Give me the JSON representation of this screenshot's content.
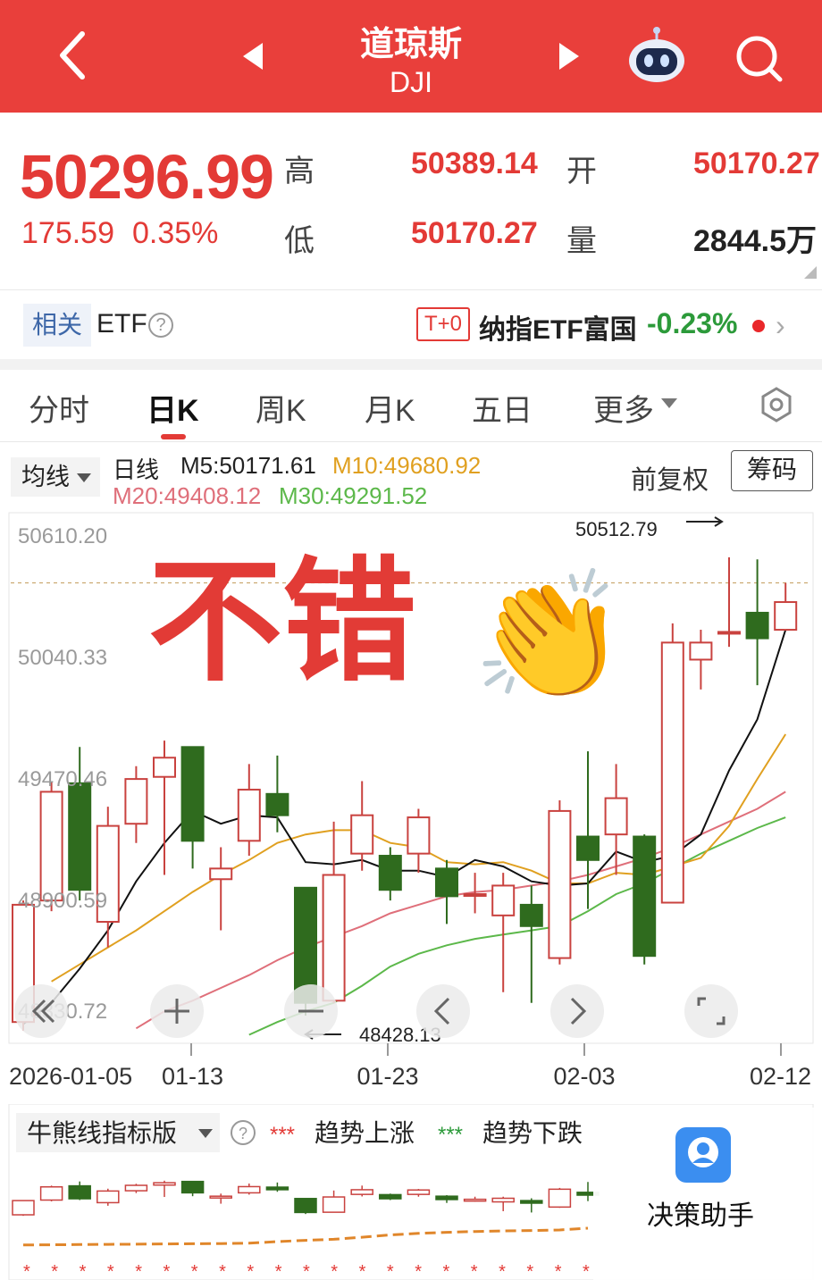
{
  "header": {
    "title": "道琼斯",
    "subtitle": "DJI"
  },
  "quote": {
    "price": "50296.99",
    "change": "175.59",
    "change_pct": "0.35%",
    "high_label": "高",
    "high": "50389.14",
    "low_label": "低",
    "low": "50170.27",
    "open_label": "开",
    "open": "50170.27",
    "volume_label": "量",
    "volume": "2844.5万"
  },
  "etf": {
    "tag": "相关",
    "label": "ETF",
    "help": "?",
    "t0": "T+0",
    "fund_name": "纳指ETF富国",
    "fund_change": "-0.23%",
    "chevron": "›"
  },
  "tabs": [
    "分时",
    "日K",
    "周K",
    "月K",
    "五日",
    "更多"
  ],
  "indicator": {
    "selector": "均线",
    "period": "日线",
    "m5": "M5:50171.61",
    "m10": "M10:49680.92",
    "m20": "M20:49408.12",
    "m30": "M30:49291.52",
    "adjust": "前复权",
    "chip": "筹码"
  },
  "colors": {
    "brand": "#e93f3b",
    "up": "#c9423f",
    "down": "#2f6b1e",
    "m5": "#111111",
    "m10": "#e0a020",
    "m20": "#df6f7a",
    "m30": "#5cb84a"
  },
  "overlay": {
    "sticker_text": "不错",
    "sticker_emoji": "👏"
  },
  "chart_data": {
    "type": "candlestick",
    "y_ticks": [
      "50610.20",
      "50040.33",
      "49470.46",
      "48900.59",
      "48330.72"
    ],
    "x_ticks": [
      "2026-01-05",
      "01-13",
      "01-23",
      "02-03",
      "02-12"
    ],
    "ylim": [
      48330.72,
      50610.2
    ],
    "max_label": "50512.79",
    "min_label": "48428.13",
    "candles": [
      {
        "o": 48330,
        "h": 48900,
        "l": 48290,
        "c": 48880
      },
      {
        "o": 48900,
        "h": 49460,
        "l": 48850,
        "c": 49410
      },
      {
        "o": 49450,
        "h": 49620,
        "l": 48900,
        "c": 48950
      },
      {
        "o": 48800,
        "h": 49340,
        "l": 48680,
        "c": 49250
      },
      {
        "o": 49260,
        "h": 49530,
        "l": 49170,
        "c": 49470
      },
      {
        "o": 49480,
        "h": 49650,
        "l": 49020,
        "c": 49570
      },
      {
        "o": 49620,
        "h": 49620,
        "l": 49050,
        "c": 49180
      },
      {
        "o": 49000,
        "h": 49150,
        "l": 48760,
        "c": 49050
      },
      {
        "o": 49180,
        "h": 49540,
        "l": 49110,
        "c": 49420
      },
      {
        "o": 49400,
        "h": 49580,
        "l": 49220,
        "c": 49300
      },
      {
        "o": 48960,
        "h": 48960,
        "l": 48360,
        "c": 48420
      },
      {
        "o": 48430,
        "h": 49270,
        "l": 48420,
        "c": 49020
      },
      {
        "o": 49120,
        "h": 49460,
        "l": 49040,
        "c": 49300
      },
      {
        "o": 49110,
        "h": 49150,
        "l": 48900,
        "c": 48950
      },
      {
        "o": 49120,
        "h": 49330,
        "l": 49030,
        "c": 49290
      },
      {
        "o": 49050,
        "h": 49090,
        "l": 48790,
        "c": 48920
      },
      {
        "o": 48930,
        "h": 49030,
        "l": 48840,
        "c": 48930
      },
      {
        "o": 48830,
        "h": 49030,
        "l": 48470,
        "c": 48970
      },
      {
        "o": 48880,
        "h": 48970,
        "l": 48420,
        "c": 48780
      },
      {
        "o": 48630,
        "h": 49370,
        "l": 48600,
        "c": 49320
      },
      {
        "o": 49200,
        "h": 49600,
        "l": 48860,
        "c": 49090
      },
      {
        "o": 49210,
        "h": 49540,
        "l": 49020,
        "c": 49380
      },
      {
        "o": 49200,
        "h": 49210,
        "l": 48600,
        "c": 48640
      },
      {
        "o": 48890,
        "h": 50200,
        "l": 48890,
        "c": 50110
      },
      {
        "o": 50030,
        "h": 50170,
        "l": 49890,
        "c": 50110
      },
      {
        "o": 50160,
        "h": 50510,
        "l": 50090,
        "c": 50160
      },
      {
        "o": 50250,
        "h": 50500,
        "l": 49910,
        "c": 50130
      },
      {
        "o": 50170,
        "h": 50390,
        "l": 50170,
        "c": 50300
      }
    ],
    "ma5": [
      48320,
      48420,
      48580,
      48760,
      48990,
      49170,
      49320,
      49260,
      49300,
      49290,
      49080,
      49070,
      49090,
      49040,
      49040,
      49010,
      49090,
      49060,
      48990,
      48970,
      48980,
      49130,
      49080,
      49110,
      49210,
      49510,
      49750,
      50170
    ],
    "ma10": [
      null,
      48520,
      48600,
      48680,
      48760,
      48850,
      48940,
      49020,
      49090,
      49170,
      49210,
      49230,
      49230,
      49170,
      49150,
      49080,
      49070,
      49080,
      49040,
      48980,
      48980,
      49030,
      49020,
      49060,
      49100,
      49250,
      49470,
      49680
    ],
    "ma20": [
      null,
      null,
      null,
      null,
      48300,
      48380,
      48430,
      48490,
      48550,
      48620,
      48680,
      48730,
      48780,
      48840,
      48880,
      48920,
      48940,
      48950,
      48970,
      48990,
      49020,
      49060,
      49100,
      49150,
      49210,
      49270,
      49330,
      49410
    ],
    "ma30": [
      null,
      null,
      null,
      null,
      null,
      null,
      null,
      null,
      48270,
      48330,
      48380,
      48420,
      48500,
      48590,
      48650,
      48690,
      48720,
      48740,
      48760,
      48780,
      48850,
      48930,
      48980,
      49050,
      49120,
      49180,
      49240,
      49290
    ]
  },
  "sub_panel": {
    "title": "牛熊线指标版",
    "help": "?",
    "legend_up_stars": "***",
    "legend_up": "趋势上涨",
    "legend_down_stars": "***",
    "legend_down": "趋势下跌",
    "assist_label": "决策助手"
  }
}
